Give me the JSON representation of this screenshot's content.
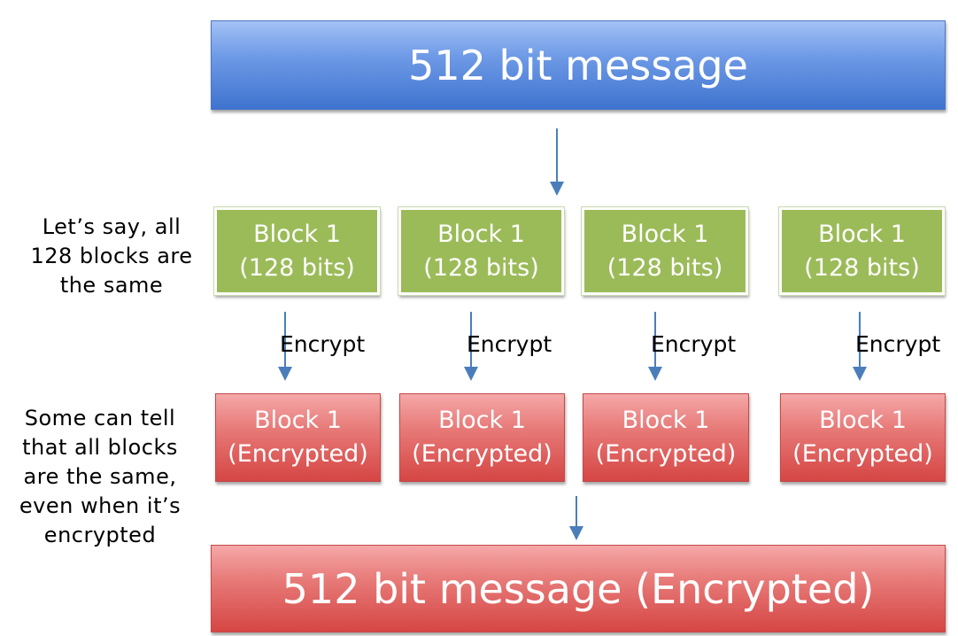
{
  "message": {
    "title": "512 bit message",
    "encrypted_title": "512 bit message (Encrypted)"
  },
  "blocks": [
    {
      "name": "Block 1",
      "size": "(128 bits)",
      "encrypted": "(Encrypted)"
    },
    {
      "name": "Block 1",
      "size": "(128 bits)",
      "encrypted": "(Encrypted)"
    },
    {
      "name": "Block 1",
      "size": "(128 bits)",
      "encrypted": "(Encrypted)"
    },
    {
      "name": "Block 1",
      "size": "(128 bits)",
      "encrypted": "(Encrypted)"
    }
  ],
  "encrypt_label": "Encrypt",
  "notes": {
    "same_blocks": [
      "Let’s say, all",
      "128 blocks are",
      "the same"
    ],
    "can_tell": [
      "Some can tell",
      "that all blocks",
      "are the same,",
      "even when it’s",
      "encrypted"
    ]
  },
  "colors": {
    "message": "#4f81bd",
    "plain_block": "#9bbb59",
    "encrypted_block": "#c0504d",
    "arrow": "#4a7ebb"
  }
}
